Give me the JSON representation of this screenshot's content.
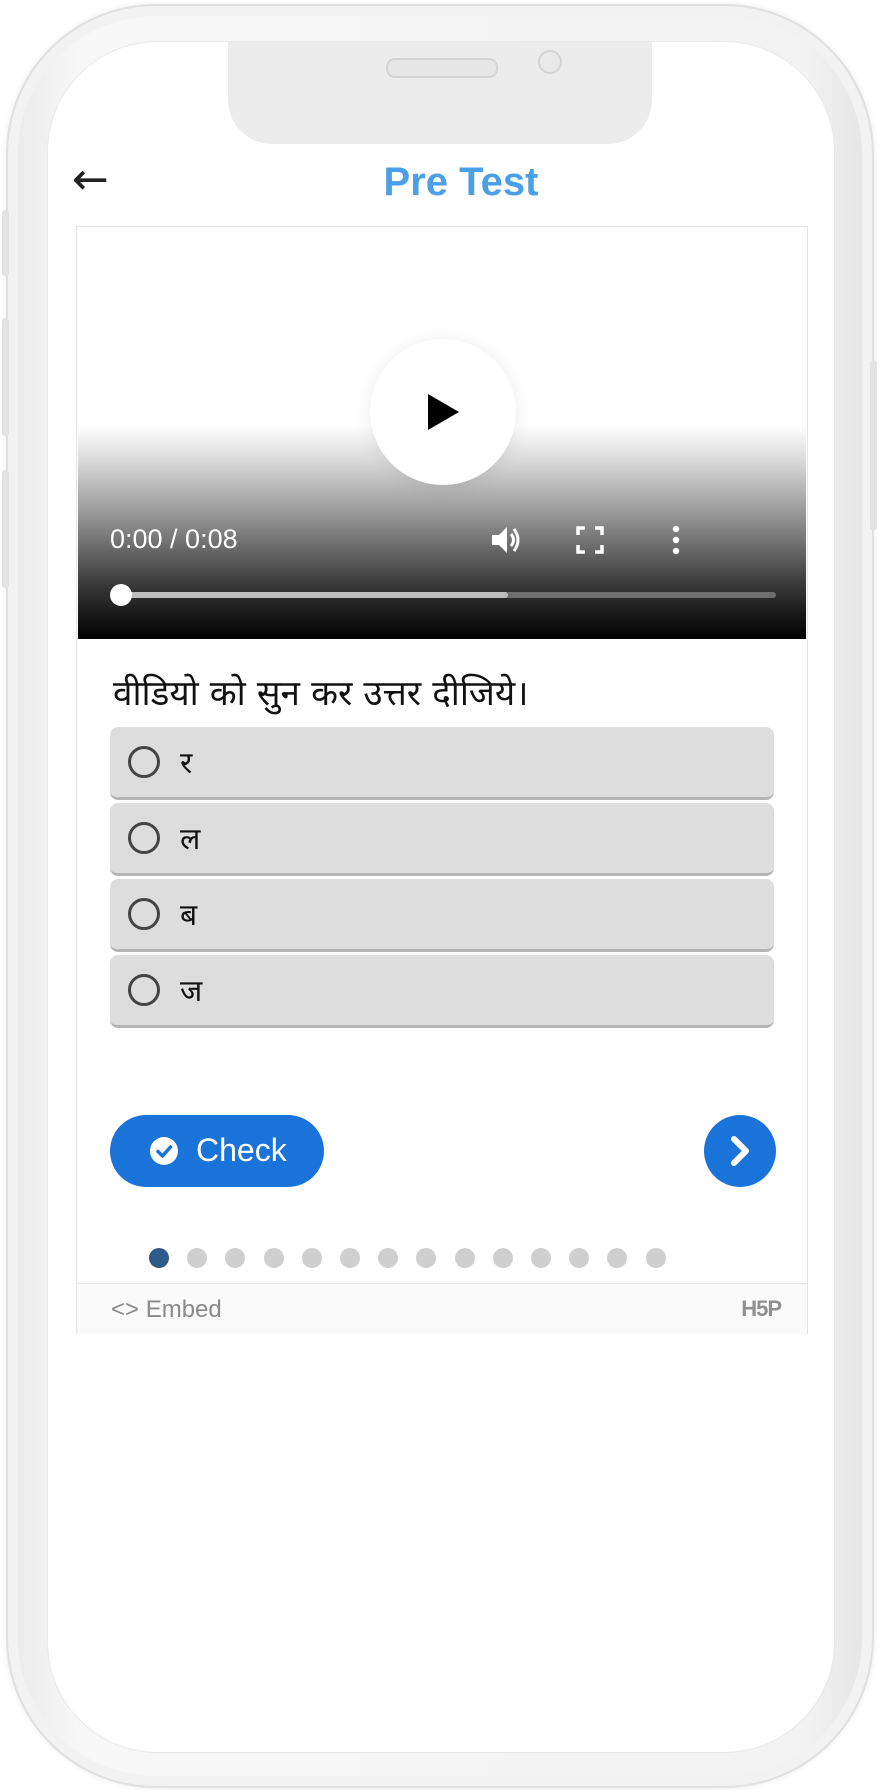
{
  "header": {
    "back_icon": "←",
    "title": "Pre Test"
  },
  "video": {
    "current_time": "0:00",
    "duration": "0:08",
    "time_display": "0:00 / 0:08",
    "played_fraction": 0.0,
    "buffered_fraction": 0.59
  },
  "question": {
    "text": "वीडियो को सुन कर उत्तर दीजिये।",
    "options": [
      {
        "label": "र"
      },
      {
        "label": "ल"
      },
      {
        "label": "ब"
      },
      {
        "label": "ज"
      }
    ]
  },
  "actions": {
    "check_label": "Check",
    "next_icon": "chevron-right-icon"
  },
  "pagination": {
    "total": 14,
    "current": 1
  },
  "footer": {
    "embed_icon": "<>",
    "embed_label": "Embed",
    "logo_text": "H5P"
  },
  "colors": {
    "title": "#4b9fe6",
    "primary": "#1a73d9",
    "option_bg": "#dddddd",
    "active_dot": "#2e5b8a"
  }
}
